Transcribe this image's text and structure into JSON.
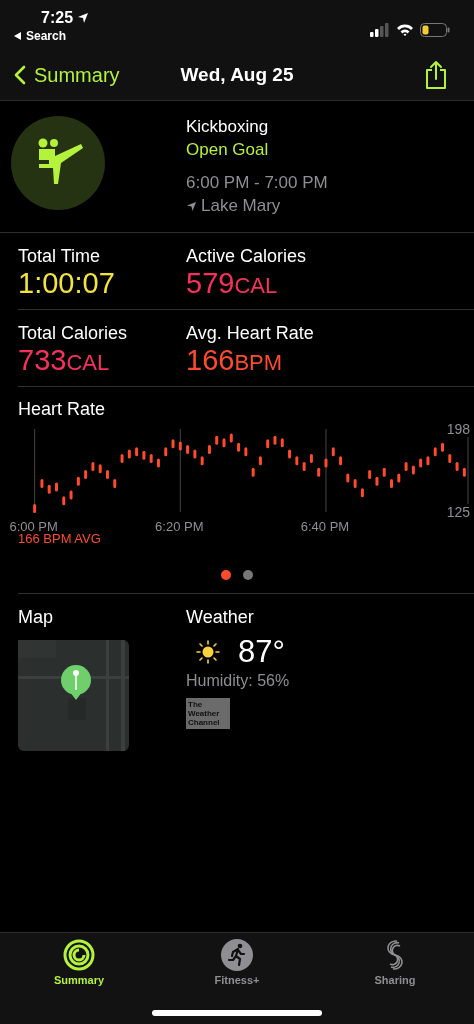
{
  "status_bar": {
    "time": "7:25",
    "back_label": "Search"
  },
  "nav": {
    "back": "Summary",
    "title": "Wed, Aug 25"
  },
  "workout": {
    "name": "Kickboxing",
    "goal": "Open Goal",
    "time_range": "6:00 PM - 7:00 PM",
    "location": "Lake Mary"
  },
  "stats": [
    {
      "label": "Total Time",
      "value": "1:00:07",
      "color": "#f2e33d"
    },
    {
      "label": "Active Calories",
      "value": "579",
      "unit": "CAL",
      "color": "#f9315a"
    },
    {
      "label": "Total Calories",
      "value": "733",
      "unit": "CAL",
      "color": "#f9315a"
    },
    {
      "label": "Avg. Heart Rate",
      "value": "166",
      "unit": "BPM",
      "color": "#ff4b2b"
    }
  ],
  "heart_rate": {
    "title": "Heart Rate",
    "average": "166 BPM AVG",
    "chart_data": {
      "type": "scatter",
      "grid": true,
      "ylim": [
        125,
        198
      ],
      "yticks": [
        125,
        198
      ],
      "categories": [
        "6:00 PM",
        null,
        null,
        null,
        null,
        null,
        null,
        null,
        null,
        null,
        null,
        null,
        null,
        null,
        null,
        null,
        null,
        null,
        null,
        null,
        "6:20 PM",
        null,
        null,
        null,
        null,
        null,
        null,
        null,
        null,
        null,
        null,
        null,
        null,
        null,
        null,
        null,
        null,
        null,
        null,
        null,
        "6:40 PM",
        null,
        null,
        null,
        null,
        null,
        null,
        null,
        null,
        null,
        null,
        null,
        null,
        null,
        null,
        null,
        null,
        null,
        null,
        null
      ],
      "series": [
        {
          "color": "#ff4b2b",
          "values": [
            128,
            150,
            145,
            147,
            135,
            140,
            152,
            158,
            165,
            163,
            158,
            150,
            172,
            176,
            178,
            175,
            172,
            168,
            178,
            185,
            183,
            180,
            176,
            170,
            180,
            188,
            186,
            190,
            182,
            178,
            160,
            170,
            185,
            188,
            186,
            176,
            170,
            165,
            172,
            160,
            168,
            178,
            170,
            155,
            150,
            142,
            158,
            152,
            160,
            150,
            155,
            165,
            162,
            168,
            170,
            178,
            182,
            172,
            165,
            160
          ]
        }
      ]
    }
  },
  "pages": [
    {
      "selected": true
    },
    {
      "selected": false
    }
  ],
  "map": {
    "title": "Map",
    "kind": "picture"
  },
  "weather": {
    "title": "Weather",
    "temperature": "87°",
    "humidity": "Humidity: 56%",
    "provider": "The Weather Channel"
  },
  "tabs": [
    {
      "label": "Summary",
      "selected": true,
      "kind": "rings"
    },
    {
      "label": "Fitness+",
      "selected": false,
      "kind": "runner"
    },
    {
      "label": "Sharing",
      "selected": false,
      "kind": "sharing"
    }
  ]
}
